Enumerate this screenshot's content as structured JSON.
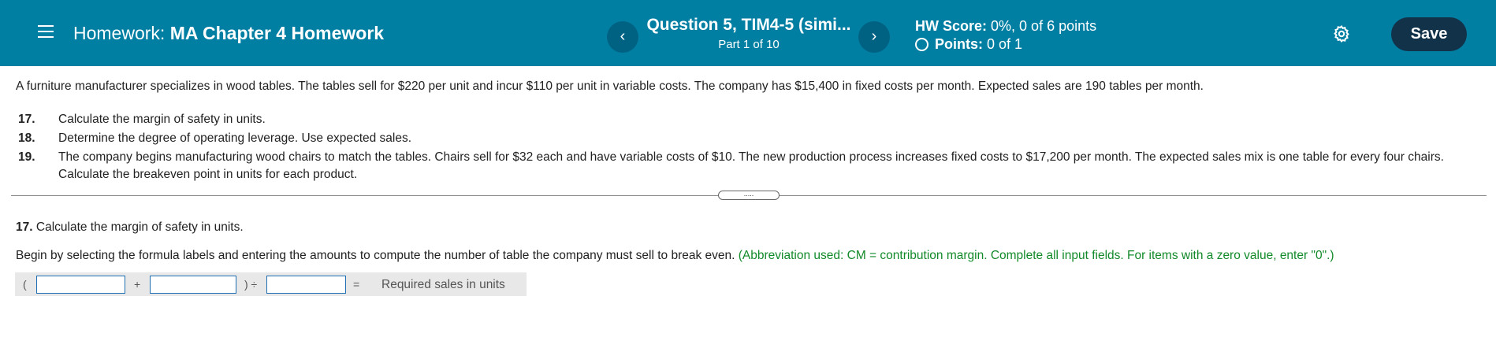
{
  "header": {
    "title_prefix": "Homework:",
    "title_name": "MA Chapter 4 Homework",
    "question_title": "Question 5, TIM4-5 (simi...",
    "question_part": "Part 1 of 10",
    "prev_label": "‹",
    "next_label": "›",
    "hw_score_label": "HW Score:",
    "hw_score_value": "0%, 0 of 6 points",
    "points_label": "Points:",
    "points_value": "0 of 1",
    "save_label": "Save"
  },
  "problem": {
    "statement": "A furniture manufacturer specializes in wood tables. The tables sell for $220 per unit and incur $110 per unit in variable costs. The company has $15,400 in fixed costs per month. Expected sales are 190 tables per month.",
    "items": [
      {
        "num": "17.",
        "text": "Calculate the margin of safety in units."
      },
      {
        "num": "18.",
        "text": "Determine the degree of operating leverage. Use expected sales."
      },
      {
        "num": "19.",
        "text": "The company begins manufacturing wood chairs to match the tables. Chairs sell for $32 each and have variable costs of $10. The new production process increases fixed costs to $17,200 per month. The expected sales mix is one table for every four chairs. Calculate the breakeven point in units for each product."
      }
    ]
  },
  "divider": {
    "handle_label": "....."
  },
  "question": {
    "number": "17.",
    "text": "Calculate the margin of safety in units.",
    "instruction": "Begin by selecting the formula labels and entering the amounts to compute the number of table the company must sell to break even.",
    "hint": "(Abbreviation used: CM = contribution margin. Complete all input fields. For items with a zero value, enter \"0\".)"
  },
  "formula": {
    "open_paren": "(",
    "plus": "+",
    "close_div": ") ÷",
    "equals": "=",
    "result_label": "Required sales in units",
    "input1_value": "",
    "input2_value": "",
    "input3_value": ""
  },
  "colors": {
    "header_bg": "#007fa3",
    "save_bg": "#12324a",
    "hint_green": "#128a2a",
    "input_border": "#1f6fb2"
  },
  "icons": [
    "menu-icon",
    "chevron-left-icon",
    "chevron-right-icon",
    "status-circle-icon",
    "gear-icon"
  ]
}
